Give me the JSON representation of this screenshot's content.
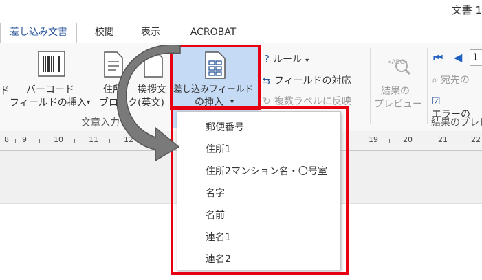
{
  "window": {
    "title": "文書 1"
  },
  "tabs": [
    {
      "label": "差し込み文書",
      "active": true
    },
    {
      "label": "校閲"
    },
    {
      "label": "表示"
    },
    {
      "label": "ACROBAT"
    }
  ],
  "ribbon": {
    "cut_label_left": "ド",
    "barcode": {
      "line1": "バーコード",
      "line2": "フィールドの挿入"
    },
    "address_block": {
      "line1": "住所",
      "line2": "ブロック"
    },
    "greeting": {
      "line1": "挨拶文",
      "line2": "(英文)"
    },
    "merge_field": {
      "line1": "差し込みフィールド",
      "line2": "の挿入"
    },
    "rules": "ルール",
    "match_fields": "フィールドの対応",
    "update_labels": "複数ラベルに反映",
    "preview": {
      "line1": "結果の",
      "line2": "プレビュー"
    },
    "recipient_cut": "宛先の",
    "error_cut": "エラーの",
    "nav_record_cut": "1",
    "group_write_insert": "文章入力と",
    "group_preview_cut": "結果のプレビ"
  },
  "ruler": {
    "numbers_left": [
      "8",
      "9",
      "10",
      "11",
      "12"
    ],
    "numbers_right": [
      "19",
      "20",
      "21",
      "22"
    ]
  },
  "dropdown": {
    "items": [
      "郵便番号",
      "住所1",
      "住所2マンション名・〇号室",
      "名字",
      "名前",
      "連名1",
      "連名2"
    ]
  },
  "colors": {
    "highlight_outline": "#e60012",
    "button_selected": "#c5daf4",
    "accent_blue": "#2b579a",
    "arrow_gray": "#7a7a7a",
    "nav_blue": "#1f5fbf"
  }
}
